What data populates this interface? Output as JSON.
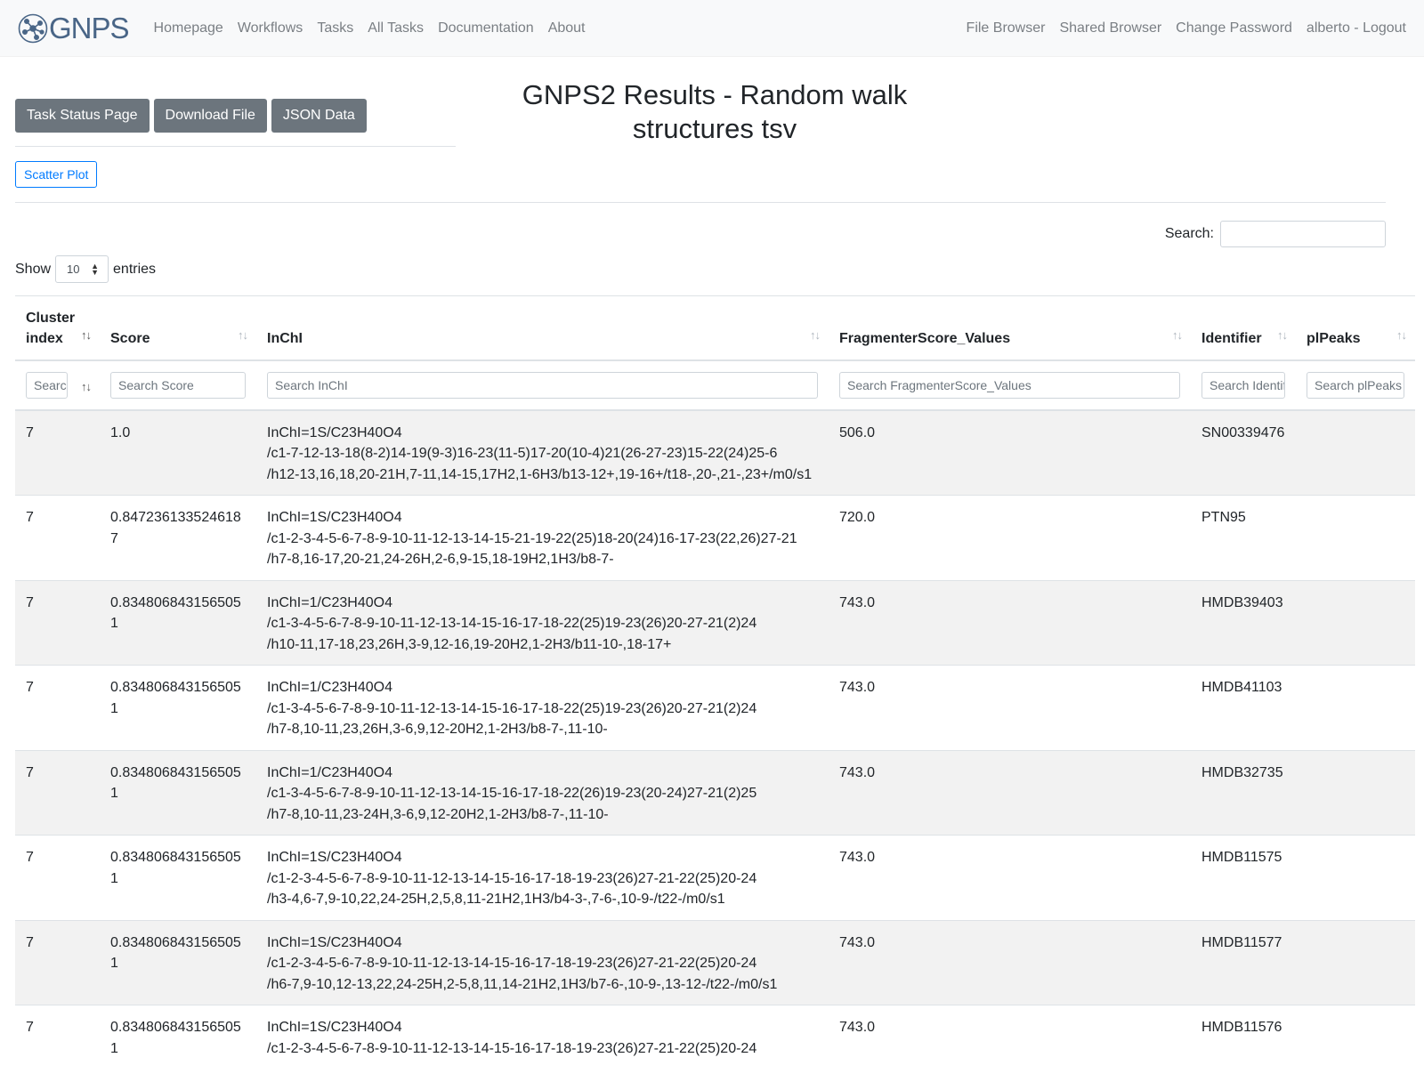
{
  "nav": {
    "brand": "GNPS",
    "left": [
      "Homepage",
      "Workflows",
      "Tasks",
      "All Tasks",
      "Documentation",
      "About"
    ],
    "right": [
      "File Browser",
      "Shared Browser",
      "Change Password",
      "alberto - Logout"
    ]
  },
  "buttons": {
    "task_status": "Task Status Page",
    "download": "Download File",
    "json": "JSON Data",
    "scatter": "Scatter Plot"
  },
  "title": "GNPS2 Results - Random walk structures tsv",
  "search": {
    "label": "Search:"
  },
  "length": {
    "show": "Show",
    "value": "10",
    "entries": "entries"
  },
  "table": {
    "columns": [
      {
        "label": "Cluster index",
        "placeholder": "Search Cluster index"
      },
      {
        "label": "Score",
        "placeholder": "Search Score"
      },
      {
        "label": "InChI",
        "placeholder": "Search InChI"
      },
      {
        "label": "FragmenterScore_Values",
        "placeholder": "Search FragmenterScore_Values"
      },
      {
        "label": "Identifier",
        "placeholder": "Search Identifier"
      },
      {
        "label": "plPeaks",
        "placeholder": "Search plPeaks"
      }
    ],
    "rows": [
      {
        "cluster": "7",
        "score": "1.0",
        "inchi": [
          "InChI=1S/C23H40O4",
          "/c1-7-12-13-18(8-2)14-19(9-3)16-23(11-5)17-20(10-4)21(26-27-23)15-22(24)25-6",
          "/h12-13,16,18,20-21H,7-11,14-15,17H2,1-6H3/b13-12+,19-16+/t18-,20-,21-,23+/m0/s1"
        ],
        "frag": "506.0",
        "id": "SN00339476",
        "peaks": ""
      },
      {
        "cluster": "7",
        "score": "0.8472361335246187",
        "inchi": [
          "InChI=1S/C23H40O4",
          "/c1-2-3-4-5-6-7-8-9-10-11-12-13-14-15-21-19-22(25)18-20(24)16-17-23(22,26)27-21",
          "/h7-8,16-17,20-21,24-26H,2-6,9-15,18-19H2,1H3/b8-7-"
        ],
        "frag": "720.0",
        "id": "PTN95",
        "peaks": ""
      },
      {
        "cluster": "7",
        "score": "0.8348068431565051",
        "inchi": [
          "InChI=1/C23H40O4",
          "/c1-3-4-5-6-7-8-9-10-11-12-13-14-15-16-17-18-22(25)19-23(26)20-27-21(2)24",
          "/h10-11,17-18,23,26H,3-9,12-16,19-20H2,1-2H3/b11-10-,18-17+"
        ],
        "frag": "743.0",
        "id": "HMDB39403",
        "peaks": ""
      },
      {
        "cluster": "7",
        "score": "0.8348068431565051",
        "inchi": [
          "InChI=1/C23H40O4",
          "/c1-3-4-5-6-7-8-9-10-11-12-13-14-15-16-17-18-22(25)19-23(26)20-27-21(2)24",
          "/h7-8,10-11,23,26H,3-6,9,12-20H2,1-2H3/b8-7-,11-10-"
        ],
        "frag": "743.0",
        "id": "HMDB41103",
        "peaks": ""
      },
      {
        "cluster": "7",
        "score": "0.8348068431565051",
        "inchi": [
          "InChI=1/C23H40O4",
          "/c1-3-4-5-6-7-8-9-10-11-12-13-14-15-16-17-18-22(26)19-23(20-24)27-21(2)25",
          "/h7-8,10-11,23-24H,3-6,9,12-20H2,1-2H3/b8-7-,11-10-"
        ],
        "frag": "743.0",
        "id": "HMDB32735",
        "peaks": ""
      },
      {
        "cluster": "7",
        "score": "0.8348068431565051",
        "inchi": [
          "InChI=1S/C23H40O4",
          "/c1-2-3-4-5-6-7-8-9-10-11-12-13-14-15-16-17-18-19-23(26)27-21-22(25)20-24",
          "/h3-4,6-7,9-10,22,24-25H,2,5,8,11-21H2,1H3/b4-3-,7-6-,10-9-/t22-/m0/s1"
        ],
        "frag": "743.0",
        "id": "HMDB11575",
        "peaks": ""
      },
      {
        "cluster": "7",
        "score": "0.8348068431565051",
        "inchi": [
          "InChI=1S/C23H40O4",
          "/c1-2-3-4-5-6-7-8-9-10-11-12-13-14-15-16-17-18-19-23(26)27-21-22(25)20-24",
          "/h6-7,9-10,12-13,22,24-25H,2-5,8,11,14-21H2,1H3/b7-6-,10-9-,13-12-/t22-/m0/s1"
        ],
        "frag": "743.0",
        "id": "HMDB11577",
        "peaks": ""
      },
      {
        "cluster": "7",
        "score": "0.8348068431565051",
        "inchi": [
          "InChI=1S/C23H40O4",
          "/c1-2-3-4-5-6-7-8-9-10-11-12-13-14-15-16-17-18-19-23(26)27-21-22(25)20-24",
          ""
        ],
        "frag": "743.0",
        "id": "HMDB11576",
        "peaks": ""
      }
    ]
  },
  "colors": {
    "navbar_bg": "#f8f9fa",
    "button_dark": "#6c757d",
    "accent_blue": "#007bff",
    "stripe": "#f2f2f2"
  }
}
